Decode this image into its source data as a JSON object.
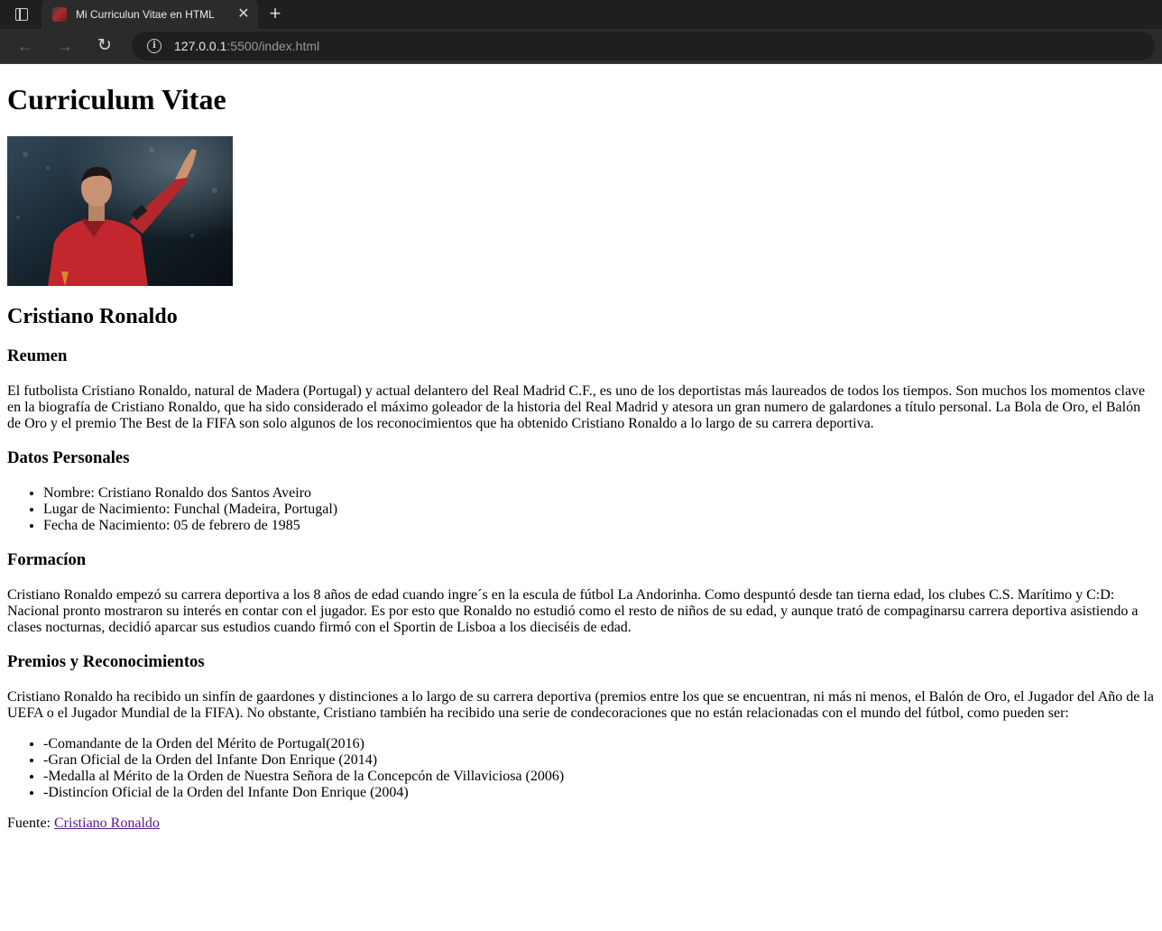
{
  "browser": {
    "tab_title": "Mi Curriculun Vitae en HTML",
    "close_glyph": "✕",
    "new_tab_glyph": "+",
    "back_glyph": "←",
    "forward_glyph": "→",
    "reload_glyph": "↻",
    "info_glyph": "i",
    "url_host": "127.0.0.1",
    "url_rest": ":5500/index.html"
  },
  "page": {
    "title": "Curriculum Vitae",
    "name": "Cristiano Ronaldo",
    "photo_alt": "Cristiano Ronaldo",
    "summary": {
      "heading": "Reumen",
      "text": "El futbolista Cristiano Ronaldo, natural de Madera (Portugal) y actual delantero del Real Madrid C.F., es uno de los deportistas más laureados de todos los tiempos. Son muchos los momentos clave en la biografía de Cristiano Ronaldo, que ha sido considerado el máximo goleador de la historia del Real Madrid y atesora un gran numero de galardones a título personal. La Bola de Oro, el Balón de Oro y el premio The Best de la FIFA son solo algunos de los reconocimientos que ha obtenido Cristiano Ronaldo a lo largo de su carrera deportiva."
    },
    "personal": {
      "heading": "Datos Personales",
      "items": [
        "Nombre: Cristiano Ronaldo dos Santos Aveiro",
        "Lugar de Nacimiento: Funchal (Madeira, Portugal)",
        "Fecha de Nacimiento: 05 de febrero de 1985"
      ]
    },
    "education": {
      "heading": "Formacíon",
      "text": "Cristiano Ronaldo empezó su carrera deportiva a los 8 años de edad cuando ingre´s en la escula de fútbol La Andorinha. Como despuntó desde tan tierna edad, los clubes C.S. Marítimo y C:D: Nacional pronto mostraron su interés en contar con el jugador. Es por esto que Ronaldo no estudió como el resto de niños de su edad, y aunque trató de compaginarsu carrera deportiva asistiendo a clases nocturnas, decidió aparcar sus estudios cuando firmó con el Sportin de Lisboa a los dieciséis de edad."
    },
    "awards": {
      "heading": "Premios y Reconocimientos",
      "text": "Cristiano Ronaldo ha recibido un sinfín de gaardones y distinciones a lo largo de su carrera deportiva (premios entre los que se encuentran, ni más ni menos, el Balón de Oro, el Jugador del Año de la UEFA o el Jugador Mundial de la FIFA). No obstante, Cristiano también ha recibido una serie de condecoraciones que no están relacionadas con el mundo del fútbol, como pueden ser:",
      "items": [
        "-Comandante de la Orden del Mérito de Portugal(2016)",
        "-Gran Oficial de la Orden del Infante Don Enrique (2014)",
        "-Medalla al Mérito de la Orden de Nuestra Señora de la Concepcón de Villaviciosa (2006)",
        "-Distincíon Oficial de la Orden del Infante Don Enrique (2004)"
      ]
    },
    "source": {
      "label": "Fuente: ",
      "link_text": "Cristiano Ronaldo"
    }
  }
}
